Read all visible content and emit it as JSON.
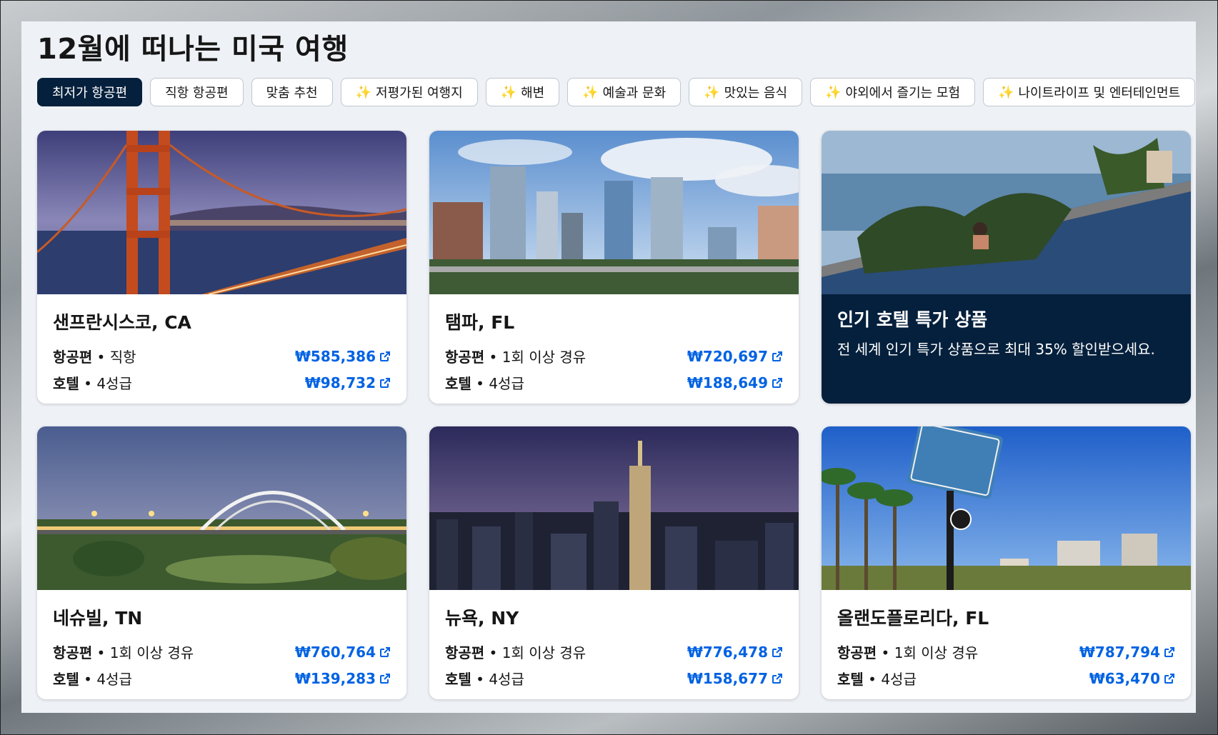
{
  "page": {
    "title": "12월에 떠나는 미국 여행"
  },
  "chips": [
    {
      "label": "최저가 항공편",
      "sparkle": false,
      "active": true
    },
    {
      "label": "직항 항공편",
      "sparkle": false,
      "active": false
    },
    {
      "label": "맞춤 추천",
      "sparkle": false,
      "active": false
    },
    {
      "label": "저평가된 여행지",
      "sparkle": true,
      "active": false
    },
    {
      "label": "해변",
      "sparkle": true,
      "active": false
    },
    {
      "label": "예술과 문화",
      "sparkle": true,
      "active": false
    },
    {
      "label": "맛있는 음식",
      "sparkle": true,
      "active": false
    },
    {
      "label": "야외에서 즐기는 모험",
      "sparkle": true,
      "active": false
    },
    {
      "label": "나이트라이프 및 엔터테인먼트",
      "sparkle": true,
      "active": false
    }
  ],
  "sparkle_icon": "✨",
  "cards": [
    {
      "city": "샌프란시스코, CA",
      "flight_label": "항공편",
      "flight_detail": " • 직항",
      "flight_price": "₩585,386",
      "hotel_label": "호텔",
      "hotel_detail": " • 4성급",
      "hotel_price": "₩98,732",
      "image": "golden-gate-bridge-photo"
    },
    {
      "city": "탬파, FL",
      "flight_label": "항공편",
      "flight_detail": " • 1회 이상 경유",
      "flight_price": "₩720,697",
      "hotel_label": "호텔",
      "hotel_detail": " • 4성급",
      "hotel_price": "₩188,649",
      "image": "tampa-skyline-photo"
    },
    {
      "promo": true,
      "title": "인기 호텔 특가 상품",
      "text": "전 세계 인기 특가 상품으로 최대 35% 할인받으세요.",
      "image": "infinity-pool-photo"
    },
    {
      "city": "네슈빌, TN",
      "flight_label": "항공편",
      "flight_detail": " • 1회 이상 경유",
      "flight_price": "₩760,764",
      "hotel_label": "호텔",
      "hotel_detail": " • 4성급",
      "hotel_price": "₩139,283",
      "image": "nashville-bridge-photo"
    },
    {
      "city": "뉴욕, NY",
      "flight_label": "항공편",
      "flight_detail": " • 1회 이상 경유",
      "flight_price": "₩776,478",
      "hotel_label": "호텔",
      "hotel_detail": " • 4성급",
      "hotel_price": "₩158,677",
      "image": "new-york-skyline-photo"
    },
    {
      "city": "올랜도플로리다, FL",
      "flight_label": "항공편",
      "flight_detail": " • 1회 이상 경유",
      "flight_price": "₩787,794",
      "hotel_label": "호텔",
      "hotel_detail": " • 4성급",
      "hotel_price": "₩63,470",
      "image": "orlando-sign-photo"
    }
  ],
  "colors": {
    "accent": "#0062e3",
    "dark_navy": "#05203c",
    "panel_bg": "#eef1f6"
  },
  "external_link_icon": "external-link-icon"
}
